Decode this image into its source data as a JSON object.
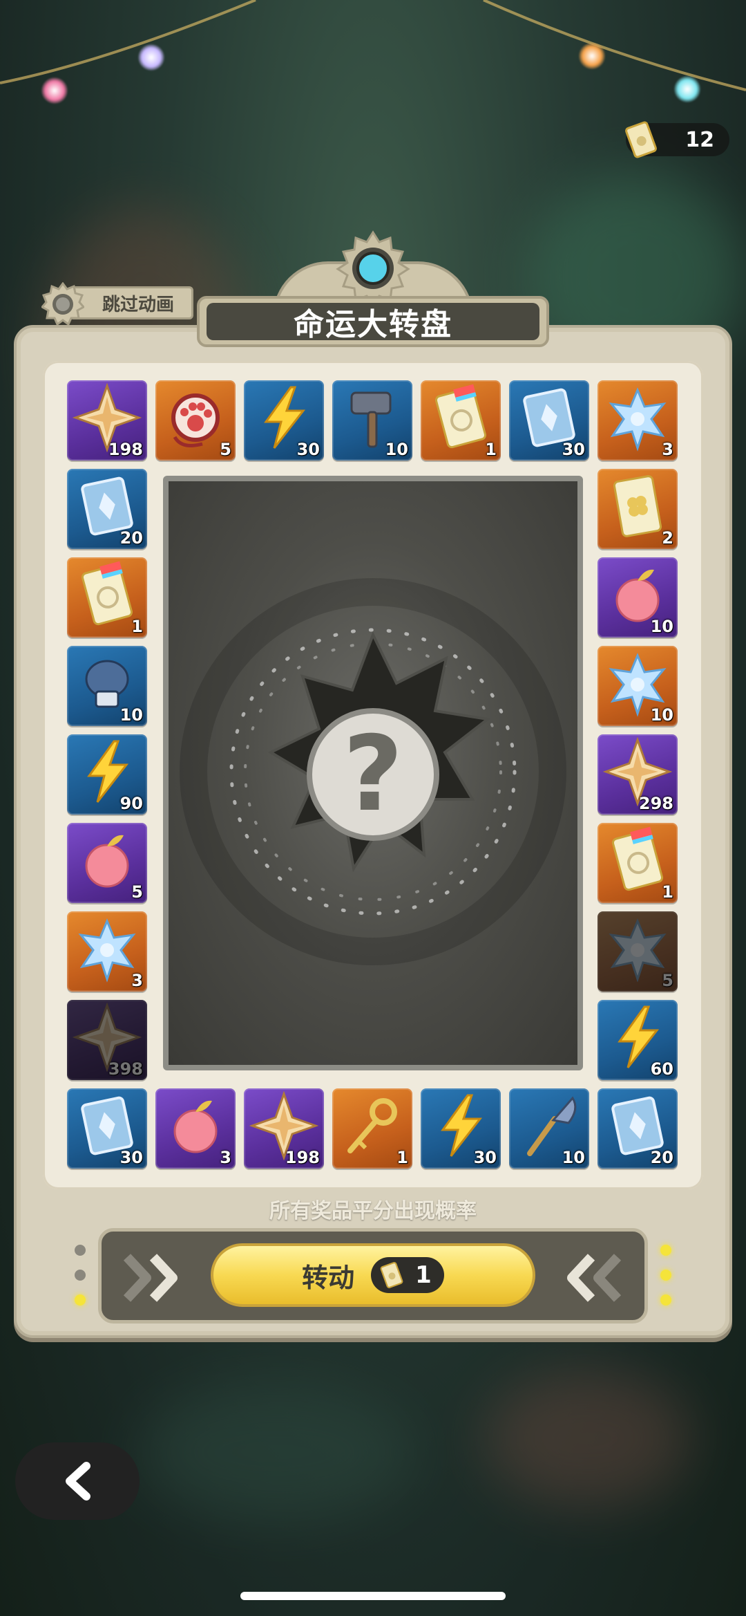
{
  "currency": {
    "icon": "ticket-icon",
    "amount": "12"
  },
  "header": {
    "title": "命运大转盘",
    "skip_label": "跳过动画"
  },
  "tiles": [
    {
      "item": "star-shard",
      "count": "198",
      "rarity": "purple"
    },
    {
      "item": "paw-pendant",
      "count": "5",
      "rarity": "orange"
    },
    {
      "item": "lightning",
      "count": "30",
      "rarity": "blue"
    },
    {
      "item": "hammer",
      "count": "10",
      "rarity": "blue"
    },
    {
      "item": "rainbow-ticket",
      "count": "1",
      "rarity": "orange"
    },
    {
      "item": "crystal-card",
      "count": "30",
      "rarity": "blue"
    },
    {
      "item": "crystal-pendant",
      "count": "3",
      "rarity": "orange"
    },
    {
      "item": "clover-ticket",
      "count": "2",
      "rarity": "orange"
    },
    {
      "item": "apple",
      "count": "10",
      "rarity": "purple"
    },
    {
      "item": "crystal-pendant",
      "count": "10",
      "rarity": "orange"
    },
    {
      "item": "star-shard",
      "count": "298",
      "rarity": "purple"
    },
    {
      "item": "rainbow-ticket",
      "count": "1",
      "rarity": "orange"
    },
    {
      "item": "crystal-pendant",
      "count": "5",
      "rarity": "orange",
      "dim": true
    },
    {
      "item": "lightning",
      "count": "60",
      "rarity": "blue"
    },
    {
      "item": "crystal-card",
      "count": "20",
      "rarity": "blue"
    },
    {
      "item": "shovel",
      "count": "10",
      "rarity": "blue"
    },
    {
      "item": "lightning",
      "count": "30",
      "rarity": "blue"
    },
    {
      "item": "key",
      "count": "1",
      "rarity": "orange"
    },
    {
      "item": "star-shard",
      "count": "198",
      "rarity": "purple"
    },
    {
      "item": "apple",
      "count": "3",
      "rarity": "purple"
    },
    {
      "item": "crystal-card",
      "count": "30",
      "rarity": "blue"
    },
    {
      "item": "star-shard",
      "count": "398",
      "rarity": "purple",
      "dim": true
    },
    {
      "item": "crystal-pendant",
      "count": "3",
      "rarity": "orange"
    },
    {
      "item": "apple",
      "count": "5",
      "rarity": "purple"
    },
    {
      "item": "lightning",
      "count": "90",
      "rarity": "blue"
    },
    {
      "item": "boxing-glove",
      "count": "10",
      "rarity": "blue"
    },
    {
      "item": "rainbow-ticket",
      "count": "1",
      "rarity": "orange"
    },
    {
      "item": "crystal-card",
      "count": "20",
      "rarity": "blue"
    }
  ],
  "center": {
    "mystery_symbol": "?"
  },
  "hint": "所有奖品平分出现概率",
  "spin": {
    "label": "转动",
    "cost": "1",
    "cost_icon": "ticket-icon"
  },
  "nav": {
    "back_icon": "back-arrow-icon"
  },
  "colors": {
    "purple": "#6a3cb5",
    "orange": "#d4711f",
    "blue": "#1f64a0",
    "gold": "#f5d14a"
  }
}
